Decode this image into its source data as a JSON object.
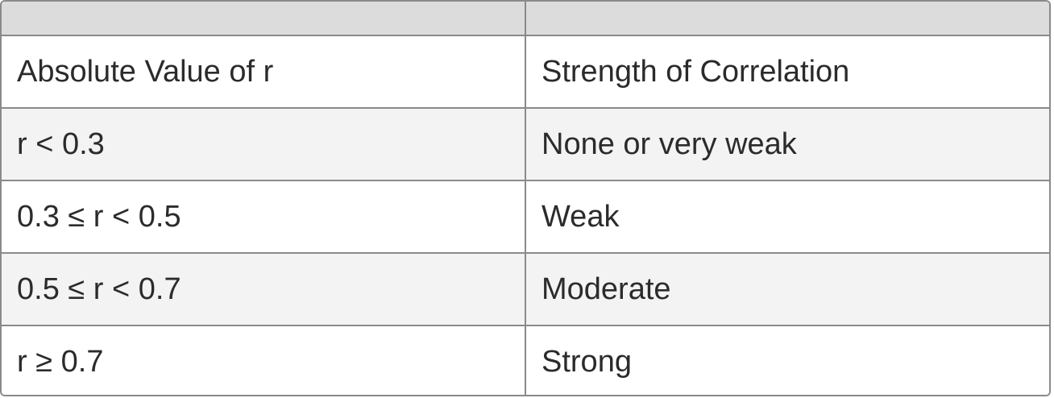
{
  "table": {
    "header": [
      "",
      ""
    ],
    "rows": [
      [
        "Absolute Value of r",
        "Strength of Correlation"
      ],
      [
        "r < 0.3",
        "None or very weak"
      ],
      [
        "0.3 ≤ r < 0.5",
        "Weak"
      ],
      [
        "0.5 ≤ r < 0.7",
        "Moderate"
      ],
      [
        "r ≥ 0.7",
        "Strong"
      ]
    ]
  },
  "colors": {
    "border": "#8a8a8a",
    "header_bg": "#dcdcdc",
    "row_alt_bg": "#f3f3f3",
    "text": "#2b2b2b"
  }
}
